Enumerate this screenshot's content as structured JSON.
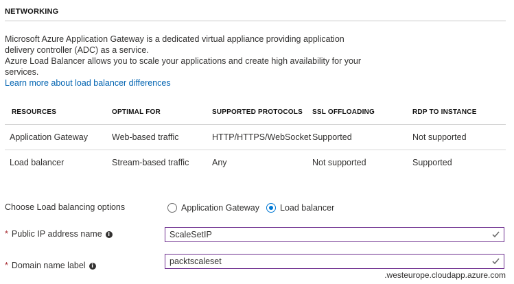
{
  "section": {
    "title": "NETWORKING"
  },
  "description": {
    "line1": "Microsoft Azure Application Gateway is a dedicated virtual appliance providing application delivery controller (ADC) as a service.",
    "line2": "Azure Load Balancer allows you to scale your applications and create high availability for your services.",
    "link": "Learn more about load balancer differences"
  },
  "table": {
    "headers": [
      "RESOURCES",
      "OPTIMAL FOR",
      "SUPPORTED PROTOCOLS",
      "SSL OFFLOADING",
      "RDP TO INSTANCE"
    ],
    "rows": [
      [
        "Application Gateway",
        "Web-based traffic",
        "HTTP/HTTPS/WebSocket",
        "Supported",
        "Not supported"
      ],
      [
        "Load balancer",
        "Stream-based traffic",
        "Any",
        "Not supported",
        "Supported"
      ]
    ]
  },
  "lb_options": {
    "label": "Choose Load balancing options",
    "options": [
      "Application Gateway",
      "Load balancer"
    ],
    "selected": "Load balancer"
  },
  "public_ip": {
    "required": "*",
    "label": "Public IP address name",
    "value": "ScaleSetIP"
  },
  "domain": {
    "required": "*",
    "label": "Domain name label",
    "value": "packtscaleset",
    "suffix": ".westeurope.cloudapp.azure.com"
  },
  "icons": {
    "info": "info-icon",
    "check": "checkmark-icon"
  },
  "colors": {
    "link": "#0063b1",
    "radio_selected": "#0078d4",
    "input_border": "#6b2a8c",
    "check": "#6b6b6b"
  }
}
